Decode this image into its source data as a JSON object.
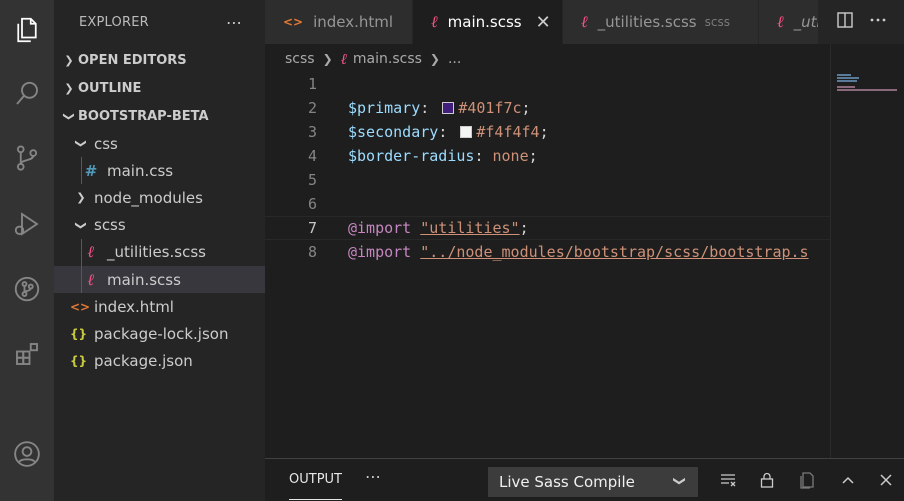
{
  "activity_bar": {
    "icons": [
      "explorer-icon",
      "search-icon",
      "source-control-icon",
      "run-debug-icon",
      "git-graph-icon",
      "extensions-icon",
      "account-icon"
    ]
  },
  "sidebar": {
    "title": "EXPLORER",
    "more_actions": "⋯",
    "sections": {
      "open_editors": "OPEN EDITORS",
      "outline": "OUTLINE",
      "project": "BOOTSTRAP-BETA"
    },
    "tree": [
      {
        "label": "css",
        "icon": "folder-open-chevron",
        "depth": 0
      },
      {
        "label": "main.css",
        "icon": "css-file-icon",
        "depth": 1
      },
      {
        "label": "node_modules",
        "icon": "folder-closed-chevron",
        "depth": 0
      },
      {
        "label": "scss",
        "icon": "folder-open-chevron",
        "depth": 0
      },
      {
        "label": "_utilities.scss",
        "icon": "scss-file-icon",
        "depth": 1
      },
      {
        "label": "main.scss",
        "icon": "scss-file-icon",
        "depth": 1,
        "selected": true
      },
      {
        "label": "index.html",
        "icon": "html-file-icon",
        "depth": 0
      },
      {
        "label": "package-lock.json",
        "icon": "json-file-icon",
        "depth": 0
      },
      {
        "label": "package.json",
        "icon": "json-file-icon",
        "depth": 0
      }
    ]
  },
  "tabs": [
    {
      "label": "index.html",
      "icon": "html-file-icon",
      "active": false
    },
    {
      "label": "main.scss",
      "icon": "scss-file-icon",
      "active": true,
      "close": "✕"
    },
    {
      "label": "_utilities.scss",
      "icon": "scss-file-icon",
      "active": false,
      "description": "scss"
    },
    {
      "label": "_uti",
      "icon": "scss-file-icon",
      "active": false
    }
  ],
  "breadcrumb": {
    "folder": "scss",
    "file": "main.scss",
    "symbol": "..."
  },
  "editor": {
    "current_line": 7,
    "lines": [
      {
        "n": "1",
        "tokens": []
      },
      {
        "n": "2",
        "tokens": [
          {
            "t": "var",
            "v": "$primary"
          },
          {
            "t": "punc",
            "v": ": "
          },
          {
            "t": "swatch",
            "color": "#401f7c"
          },
          {
            "t": "val",
            "v": "#401f7c"
          },
          {
            "t": "punc",
            "v": ";"
          }
        ]
      },
      {
        "n": "3",
        "tokens": [
          {
            "t": "var",
            "v": "$secondary"
          },
          {
            "t": "punc",
            "v": ": "
          },
          {
            "t": "swatch",
            "color": "#f4f4f4"
          },
          {
            "t": "val",
            "v": "#f4f4f4"
          },
          {
            "t": "punc",
            "v": ";"
          }
        ]
      },
      {
        "n": "4",
        "tokens": [
          {
            "t": "var",
            "v": "$border-radius"
          },
          {
            "t": "punc",
            "v": ": "
          },
          {
            "t": "val",
            "v": "none"
          },
          {
            "t": "punc",
            "v": ";"
          }
        ]
      },
      {
        "n": "5",
        "tokens": []
      },
      {
        "n": "6",
        "tokens": []
      },
      {
        "n": "7",
        "tokens": [
          {
            "t": "kw",
            "v": "@import"
          },
          {
            "t": "punc",
            "v": " "
          },
          {
            "t": "str link",
            "v": "\"utilities\""
          },
          {
            "t": "punc",
            "v": ";"
          }
        ]
      },
      {
        "n": "8",
        "tokens": [
          {
            "t": "kw",
            "v": "@import"
          },
          {
            "t": "punc",
            "v": " "
          },
          {
            "t": "str link",
            "v": "\"../node_modules/bootstrap/scss/bootstrap.s"
          }
        ]
      }
    ]
  },
  "panel": {
    "tab": "OUTPUT",
    "more_actions": "⋯",
    "channel_selected": "Live Sass Compile"
  },
  "colors": {
    "accent": "#007acc",
    "primary_swatch": "#401f7c",
    "secondary_swatch": "#f4f4f4",
    "scss_icon": "#f55385",
    "html_icon": "#e37933",
    "json_icon": "#cbcb41",
    "css_icon": "#519aba"
  }
}
